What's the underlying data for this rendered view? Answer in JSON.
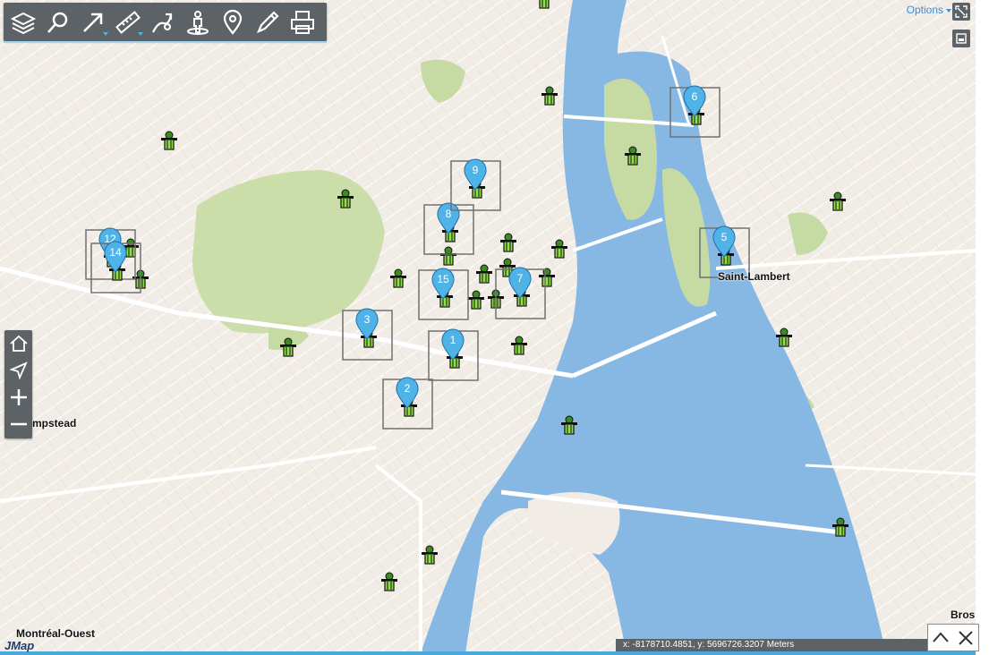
{
  "toolbar": {
    "tools": [
      {
        "icon": "layers-icon",
        "name": "layers"
      },
      {
        "icon": "search-icon",
        "name": "search"
      },
      {
        "icon": "select-arrow-icon",
        "name": "select",
        "dropdown": true
      },
      {
        "icon": "ruler-icon",
        "name": "measure",
        "dropdown": true
      },
      {
        "icon": "route-icon",
        "name": "directions"
      },
      {
        "icon": "street-view-icon",
        "name": "street-view"
      },
      {
        "icon": "location-pin-icon",
        "name": "location"
      },
      {
        "icon": "edit-pencil-icon",
        "name": "edit"
      },
      {
        "icon": "print-icon",
        "name": "print"
      }
    ]
  },
  "navigation": {
    "buttons": [
      {
        "icon": "home-icon",
        "name": "home"
      },
      {
        "icon": "locate-arrow-icon",
        "name": "geolocate"
      },
      {
        "icon": "zoom-in-icon",
        "name": "zoom-in"
      },
      {
        "icon": "zoom-out-icon",
        "name": "zoom-out"
      }
    ]
  },
  "options_label": "Options",
  "place_labels": [
    {
      "text": "Saint-Lambert"
    },
    {
      "text": "mpstead"
    },
    {
      "text": "Montréal-Ouest"
    },
    {
      "text": "Bros"
    }
  ],
  "markers": [
    "1",
    "2",
    "3",
    "5",
    "6",
    "7",
    "8",
    "9",
    "12",
    "14",
    "15"
  ],
  "coordinates": "x: -8178710.4851, y: 5696726.3207 Meters",
  "logo": "JMap",
  "colors": {
    "water": "#86b8e3",
    "land": "#f1ede6",
    "park": "#c6dba3",
    "toolbar": "#5d6266",
    "marker_pin": "#4fb3e8",
    "accent": "#3b8fd6"
  }
}
